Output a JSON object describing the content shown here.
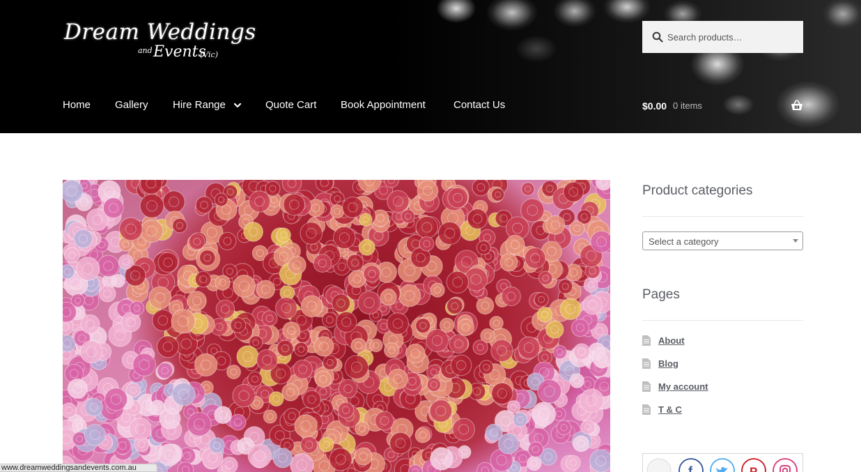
{
  "site": {
    "logo_line1": "Dream Weddings",
    "logo_and": "and",
    "logo_line2": "Events",
    "logo_vic": "(Vic)"
  },
  "search": {
    "placeholder": "Search products…"
  },
  "nav": {
    "items": [
      {
        "label": "Home"
      },
      {
        "label": "Gallery"
      },
      {
        "label": "Hire Range",
        "has_dropdown": true
      },
      {
        "label": "Quote Cart"
      },
      {
        "label": "Book Appointment"
      },
      {
        "label": "Contact Us"
      }
    ]
  },
  "cart": {
    "amount": "$0.00",
    "count": "0 items"
  },
  "sidebar": {
    "categories_title": "Product categories",
    "category_select": "Select a category",
    "pages_title": "Pages",
    "pages": [
      {
        "label": "About"
      },
      {
        "label": "Blog"
      },
      {
        "label": "My account"
      },
      {
        "label": "T & C"
      }
    ],
    "social": [
      "follow",
      "facebook",
      "twitter",
      "pinterest",
      "instagram"
    ]
  },
  "status_bar": {
    "url": "www.dreamweddingsandevents.com.au"
  },
  "colors": {
    "header_bg": "#000000",
    "text": "#43454b",
    "link": "#5a5d63",
    "facebook": "#3b5998",
    "twitter": "#55acee",
    "pinterest": "#cb2027",
    "instagram": "#d6407a"
  },
  "icons": [
    "search-icon",
    "chevron-down-icon",
    "basket-icon",
    "page-icon"
  ]
}
